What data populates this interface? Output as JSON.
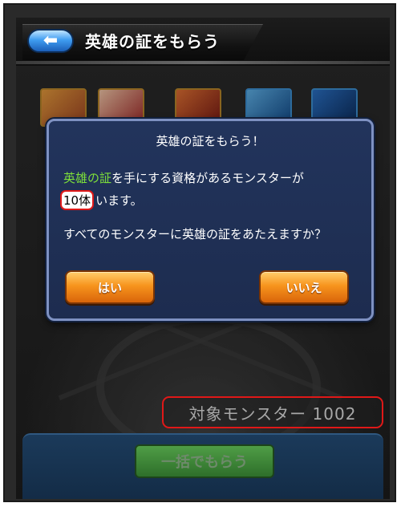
{
  "header": {
    "title": "英雄の証をもらう",
    "back_icon": "back-arrow-icon"
  },
  "dialog": {
    "title": "英雄の証をもらう！",
    "line1_highlight": "英雄の証",
    "line1_rest": "を手にする資格があるモンスターが",
    "count": "10体",
    "line2_rest": "います。",
    "line3": "すべてのモンスターに英雄の証をあたえますか？",
    "yes_label": "はい",
    "no_label": "いいえ"
  },
  "target": {
    "label": "対象モンスター 1002"
  },
  "bulk_button": {
    "label": "一括でもらう"
  },
  "colors": {
    "dialog_bg": "#22345c",
    "dialog_border": "#7e91c2",
    "button_orange": "#f7941d",
    "highlight_green": "#7ddf3a",
    "annotation_red": "#e01818",
    "back_button_blue": "#3f9df1"
  }
}
